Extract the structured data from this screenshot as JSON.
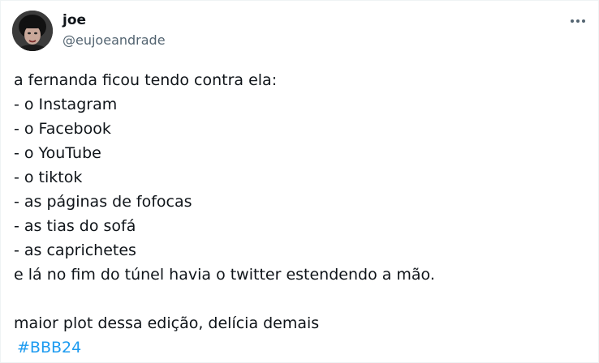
{
  "author": {
    "display_name": "joe",
    "handle": "@eujoeandrade",
    "avatar_icon": "user-avatar"
  },
  "menu": {
    "icon": "more-options-icon"
  },
  "tweet": {
    "lines": [
      "a fernanda ficou tendo contra ela:",
      "- o Instagram",
      "- o Facebook",
      "- o YouTube",
      "- o tiktok",
      "- as páginas de fofocas",
      "- as tias do sofá",
      "- as caprichetes",
      "e lá no fim do túnel havia o twitter estendendo a mão."
    ],
    "closing": "maior plot dessa edição, delícia demais",
    "hashtag": "#BBB24",
    "hashtag_color": "#1d9bf0"
  }
}
